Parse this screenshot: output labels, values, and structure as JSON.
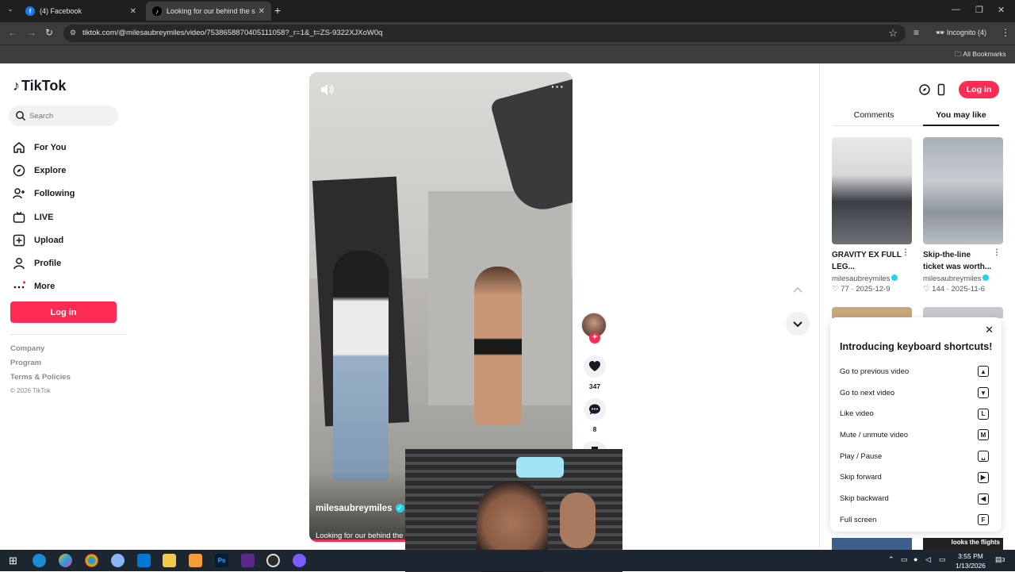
{
  "browser": {
    "tabs": [
      {
        "title": "(4) Facebook",
        "favicon": "facebook-icon",
        "active": false
      },
      {
        "title": "Looking for our behind the sce",
        "favicon": "tiktok-icon",
        "active": true
      }
    ],
    "url": "tiktok.com/@milesaubreymiles/video/7538658870405111058?_r=1&_t=ZS-9322XJXoW0q",
    "incognito_label": "Incognito (4)",
    "all_bookmarks": "All Bookmarks"
  },
  "sidebar": {
    "logo": "TikTok",
    "search_placeholder": "Search",
    "nav": [
      {
        "label": "For You",
        "icon": "home-icon"
      },
      {
        "label": "Explore",
        "icon": "compass-icon"
      },
      {
        "label": "Following",
        "icon": "following-icon"
      },
      {
        "label": "LIVE",
        "icon": "live-icon"
      },
      {
        "label": "Upload",
        "icon": "upload-icon"
      },
      {
        "label": "Profile",
        "icon": "profile-icon"
      },
      {
        "label": "More",
        "icon": "more-icon"
      }
    ],
    "login": "Log in",
    "footer": {
      "company": "Company",
      "program": "Program",
      "terms": "Terms & Policies",
      "copyright": "© 2026 TikTok"
    }
  },
  "video": {
    "author": "milesaubreymiles",
    "caption": "Looking for our behind the",
    "likes": "347",
    "comments": "8"
  },
  "right_panel": {
    "login": "Log in",
    "tabs": [
      "Comments",
      "You may like"
    ],
    "active_tab": "You may like",
    "cards": [
      {
        "title": "GRAVITY EX FULL LEG...",
        "author": "milesaubreymiles",
        "likes": "77",
        "date": "2025-12-9"
      },
      {
        "title": "Skip-the-line ticket was worth...",
        "author": "milesaubreymiles",
        "likes": "144",
        "date": "2025-11-6"
      }
    ],
    "bottom_card_text": "looks the flights"
  },
  "shortcuts": {
    "title": "Introducing keyboard shortcuts!",
    "items": [
      {
        "label": "Go to previous video",
        "key": "▲"
      },
      {
        "label": "Go to next video",
        "key": "▼"
      },
      {
        "label": "Like video",
        "key": "L"
      },
      {
        "label": "Mute / unmute video",
        "key": "M"
      },
      {
        "label": "Play / Pause",
        "key": "␣"
      },
      {
        "label": "Skip forward",
        "key": "▶"
      },
      {
        "label": "Skip backward",
        "key": "◀"
      },
      {
        "label": "Full screen",
        "key": "F"
      }
    ]
  },
  "taskbar": {
    "time": "3:55 PM",
    "date": "1/13/2026",
    "notif": "3"
  },
  "colors": {
    "accent": "#fe2c55",
    "verified": "#20d5ec"
  }
}
